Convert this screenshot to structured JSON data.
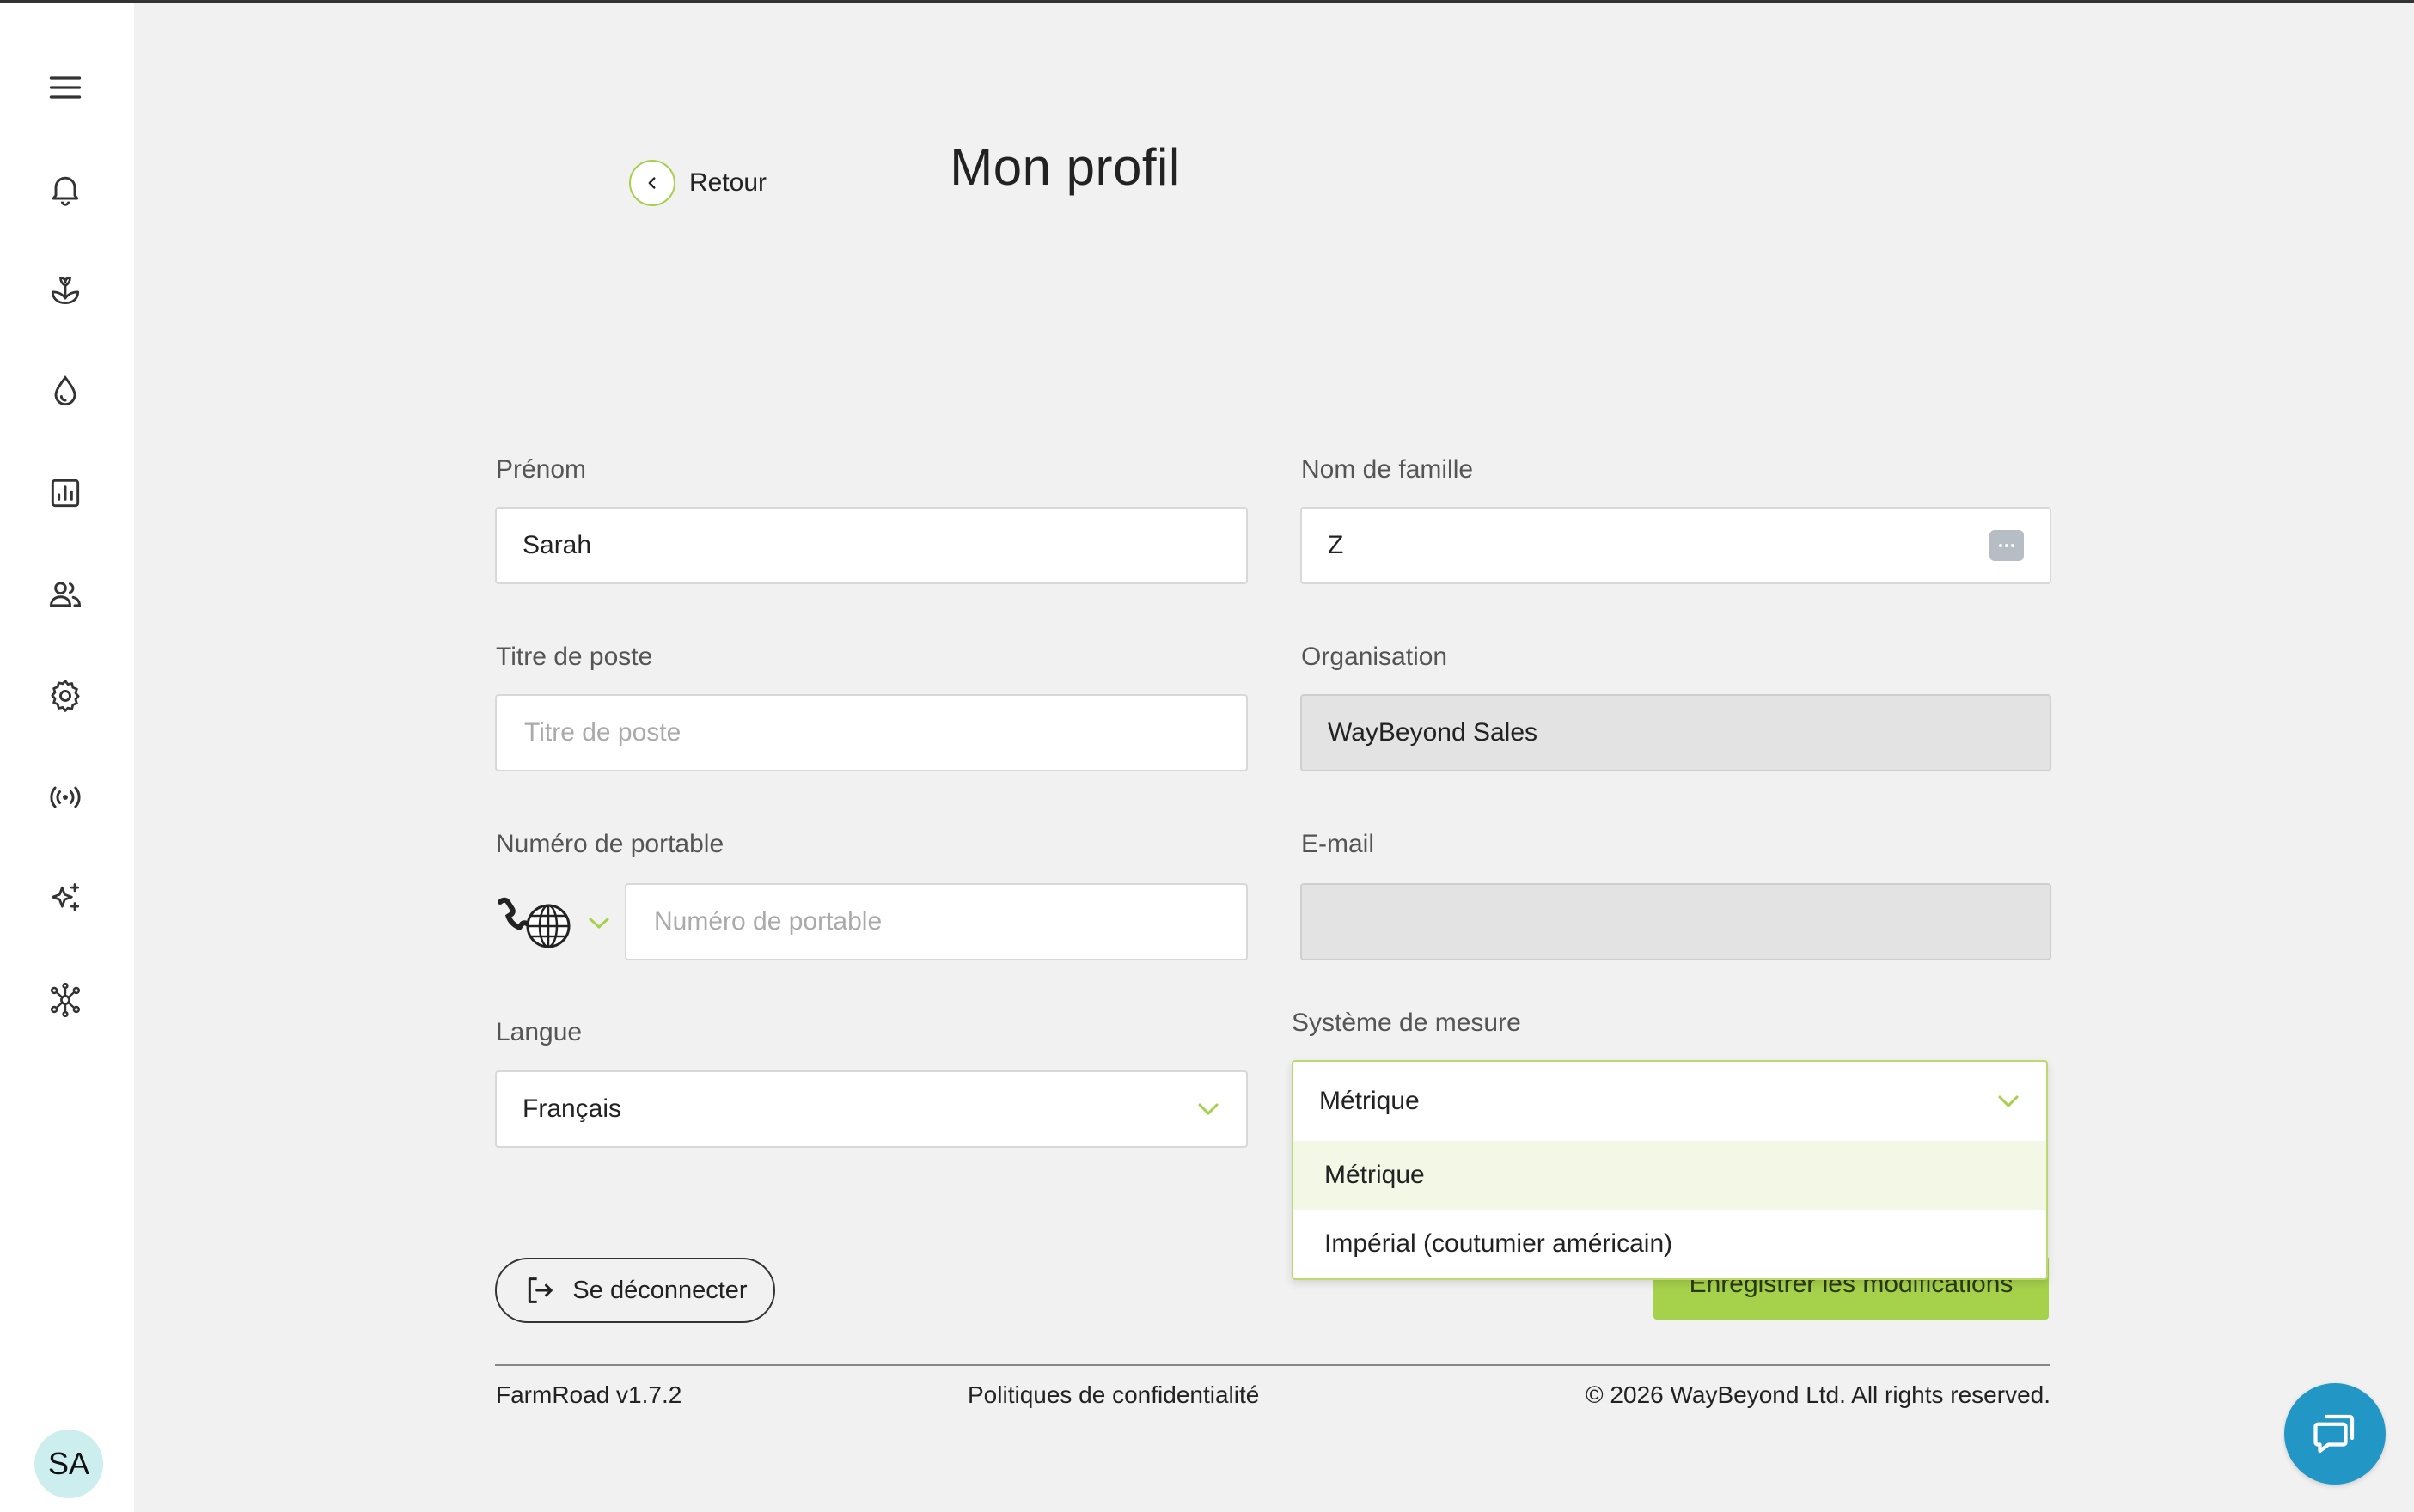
{
  "header": {
    "back_label": "Retour",
    "title": "Mon profil"
  },
  "sidebar": {
    "avatar_initials": "SA",
    "items": [
      {
        "icon": "menu-icon"
      },
      {
        "icon": "bell-icon"
      },
      {
        "icon": "plant-icon"
      },
      {
        "icon": "water-drop-icon"
      },
      {
        "icon": "bar-chart-icon"
      },
      {
        "icon": "users-icon"
      },
      {
        "icon": "gear-icon"
      },
      {
        "icon": "broadcast-icon"
      },
      {
        "icon": "sparkles-icon"
      },
      {
        "icon": "network-icon"
      }
    ]
  },
  "form": {
    "first_name": {
      "label": "Prénom",
      "value": "Sarah"
    },
    "last_name": {
      "label": "Nom de famille",
      "value": "Z"
    },
    "job_title": {
      "label": "Titre de poste",
      "placeholder": "Titre de poste"
    },
    "organisation": {
      "label": "Organisation",
      "value": "WayBeyond Sales"
    },
    "mobile": {
      "label": "Numéro de portable",
      "placeholder": "Numéro de portable"
    },
    "email": {
      "label": "E-mail",
      "value": ""
    },
    "language": {
      "label": "Langue",
      "value": "Français"
    },
    "measurement": {
      "label": "Système de mesure",
      "value": "Métrique",
      "options": [
        "Métrique",
        "Impérial (coutumier américain)"
      ]
    }
  },
  "actions": {
    "logout_label": "Se déconnecter",
    "save_label": "Enregistrer les modifications"
  },
  "footer": {
    "version": "FarmRoad v1.7.2",
    "privacy": "Politiques de confidentialité",
    "copyright": "© 2026 WayBeyond Ltd. All rights reserved."
  },
  "colors": {
    "accent": "#a6d14b",
    "chat": "#2296c4",
    "avatar_bg": "#cdeeee"
  }
}
